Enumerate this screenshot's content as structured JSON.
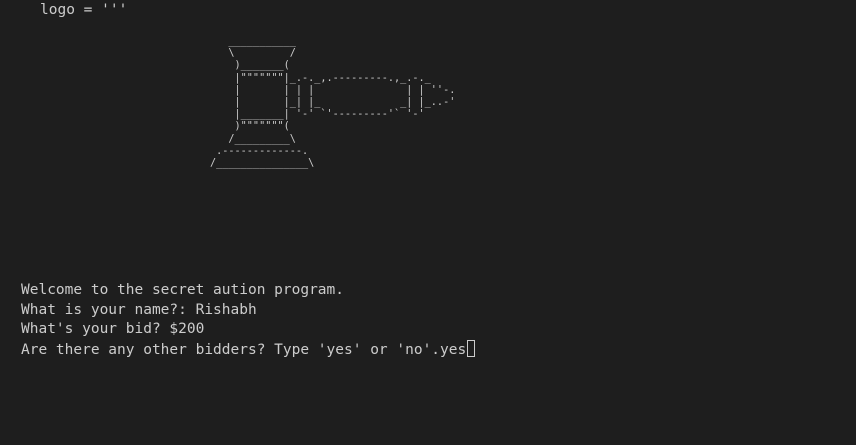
{
  "code_line": "logo = '''",
  "ascii_art": "   ___________\n   \\         /\n    )_______(\n    |\"\"\"\"\"\"\"|_.-._,.---------.,_.-._\n    |       | | |               | | ''-.\n    |       |_| |_             _| |_..-'\n    |_______| '-' `'---------'` '-'\n    )\"\"\"\"\"\"\"(\n   /_________\\\n .-------------.\n/_______________\\",
  "output_lines": [
    "Welcome to the secret aution program.",
    "What is your name?: Rishabh",
    "What's your bid? $200",
    "Are there any other bidders? Type 'yes' or 'no'.yes"
  ]
}
